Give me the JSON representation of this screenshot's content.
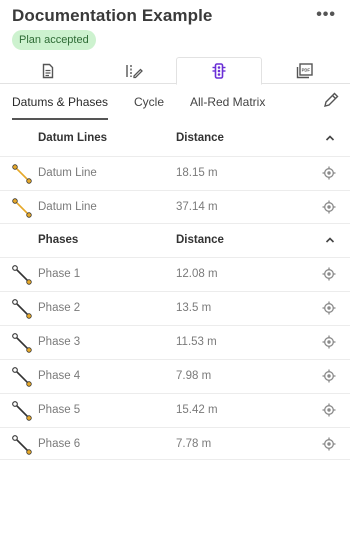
{
  "header": {
    "title": "Documentation Example",
    "more_label": "•••",
    "status_badge": "Plan accepted"
  },
  "tabs": [
    {
      "icon": "document-icon",
      "active": false
    },
    {
      "icon": "design-edit-icon",
      "active": false
    },
    {
      "icon": "traffic-light-icon",
      "active": true
    },
    {
      "icon": "pdf-icon",
      "active": false
    }
  ],
  "subnav": {
    "items": [
      "Datums & Phases",
      "Cycle",
      "All-Red Matrix"
    ],
    "active": "Datums & Phases",
    "edit_icon": "pencil-icon"
  },
  "datum_section": {
    "col_name": "Datum Lines",
    "col_distance": "Distance",
    "rows": [
      {
        "name": "Datum Line",
        "distance": "18.15 m"
      },
      {
        "name": "Datum Line",
        "distance": "37.14 m"
      }
    ]
  },
  "phase_section": {
    "col_name": "Phases",
    "col_distance": "Distance",
    "rows": [
      {
        "name": "Phase 1",
        "distance": "12.08 m"
      },
      {
        "name": "Phase 2",
        "distance": "13.5 m"
      },
      {
        "name": "Phase 3",
        "distance": "11.53 m"
      },
      {
        "name": "Phase 4",
        "distance": "7.98 m"
      },
      {
        "name": "Phase 5",
        "distance": "15.42 m"
      },
      {
        "name": "Phase 6",
        "distance": "7.78 m"
      }
    ]
  },
  "colors": {
    "accent": "#6a2fd6",
    "badge_bg": "#cdf2cf",
    "datum_line": "#e6a82a",
    "phase_line": "#333333",
    "phase_end": "#e6a82a"
  }
}
